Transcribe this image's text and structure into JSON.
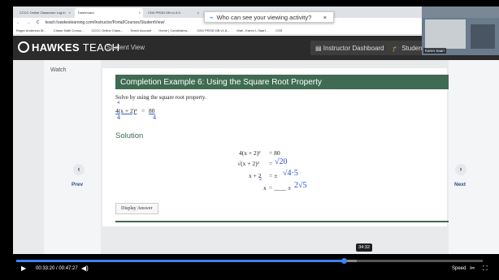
{
  "browser": {
    "tabs": [
      {
        "label": "CCCC Online Classroom Log in",
        "active": false
      },
      {
        "label": "Dashboard",
        "active": true
      },
      {
        "label": "CNX PROD DB v1.8.0",
        "active": false
      }
    ],
    "notification": {
      "text": "Who can see your viewing activity?"
    },
    "url": "teach.hawkeslearning.com/Instructor/Portal/Courses/StudentView/",
    "bookmarks": [
      "Roger Anderson M...",
      "Chase Math Consu...",
      "CCCC Online Class...",
      "Teach Account",
      "Home | Candelabra...",
      "CNX PROD DB v1.8...",
      "Mail - Karen L Saari...",
      "CSS"
    ]
  },
  "header": {
    "logo_bold": "HAWKES",
    "logo_light": "TEACH",
    "view_label": "Student View",
    "instructor_btn": "Instructor Dashboard",
    "student_btn": "Student Das"
  },
  "video_tile": {
    "name": "Karen Saari"
  },
  "lesson": {
    "watch_label": "Watch",
    "title": "Completion Example 6: Using the Square Root Property",
    "instruction": "Solve by using the square root property.",
    "problem": {
      "lhs": "4(x + 2)²",
      "rhs": "80"
    },
    "solution_label": "Solution",
    "steps": [
      {
        "lhs": "4(x + 2)²",
        "rhs": "= 80"
      },
      {
        "lhs": "√(x + 2)²",
        "rhs": "="
      },
      {
        "lhs": "x + 2",
        "rhs": "= ±"
      },
      {
        "lhs": "x",
        "rhs": "= ____ ±"
      }
    ],
    "handwriting": {
      "div_top": "4",
      "div_under_left": "4",
      "div_under_right": "4",
      "step2": "√20",
      "step3": "√4·5",
      "step4": "2√5",
      "cancel_mark": "2"
    },
    "display_answer": "Display Answer",
    "prev_label": "Prev",
    "next_label": "Next",
    "prev_icon": "‹",
    "next_icon": "›"
  },
  "player": {
    "current_time": "00:33:20",
    "duration": "00:47:27",
    "time_display": "00:33:20 / 00:47:27",
    "hover_time": "34:32",
    "progress": 0.7025,
    "buffered": 0.73,
    "speed_label": "Speed",
    "colors": {
      "accent": "#3b82f6"
    }
  }
}
